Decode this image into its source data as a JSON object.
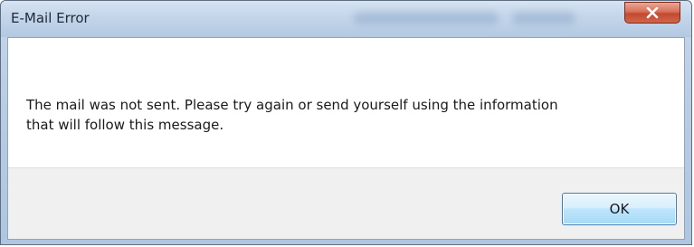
{
  "dialog": {
    "title": "E-Mail Error",
    "message": "The mail was not sent.  Please try again or send yourself using the information\nthat will follow this message.",
    "ok_label": "OK",
    "close_icon": "close-icon"
  },
  "colors": {
    "close_button": "#c8533a",
    "ok_button_border": "#3c7fb1",
    "titlebar": "#c3d5ea",
    "footer": "#f0f0f0"
  }
}
